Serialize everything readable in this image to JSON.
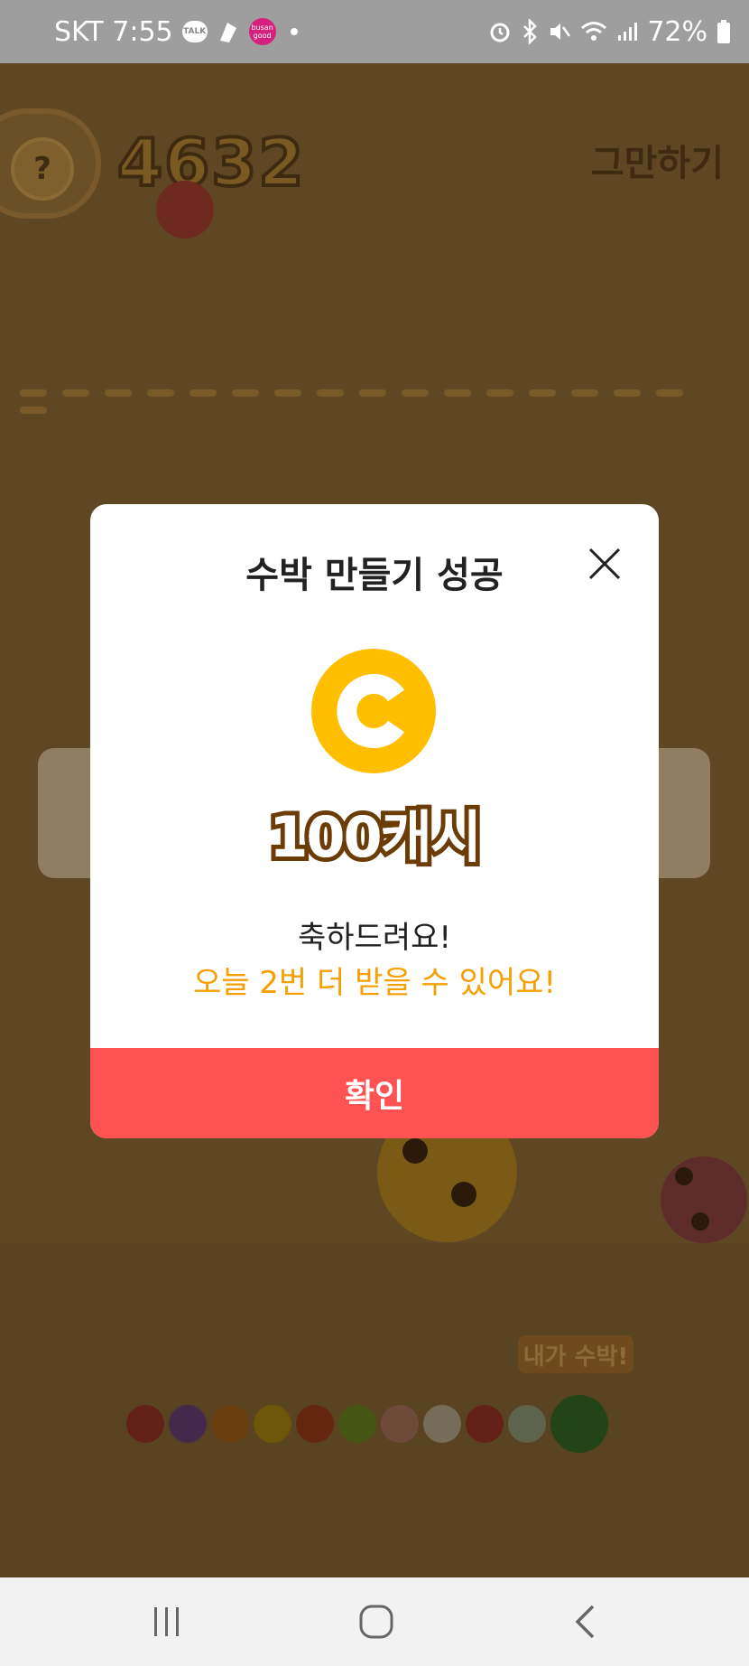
{
  "status_bar": {
    "carrier_time": "SKT 7:55",
    "talk_badge": "TALK",
    "busan_badge": "busan good",
    "battery": "72%",
    "icons": [
      "kakaotalk-icon",
      "app-icon",
      "busan-good-icon",
      "alarm-icon",
      "bluetooth-icon",
      "mute-icon",
      "wifi-icon",
      "signal-icon",
      "battery-icon"
    ]
  },
  "game": {
    "help_label": "?",
    "score": "4632",
    "quit_label": "그만하기",
    "evolution_badge": "내가 수박!",
    "evolution_colors": [
      "#b43a2a",
      "#7b4b8a",
      "#c0701a",
      "#c79a10",
      "#b7461b",
      "#7d9a25",
      "#c9856a",
      "#d6c7a0",
      "#b43b2a",
      "#aab58a",
      "#3f7b2a"
    ]
  },
  "dialog": {
    "title": "수박 만들기 성공",
    "reward": "100캐시",
    "congrats": "축하드려요!",
    "remaining": "오늘 2번 더 받을 수 있어요!",
    "confirm_label": "확인",
    "coin_color": "#ffbe00",
    "confirm_color": "#ff5252",
    "accent_color": "#f5a000"
  },
  "nav_bar": {
    "icons": [
      "recent-apps-icon",
      "home-icon",
      "back-icon"
    ]
  }
}
